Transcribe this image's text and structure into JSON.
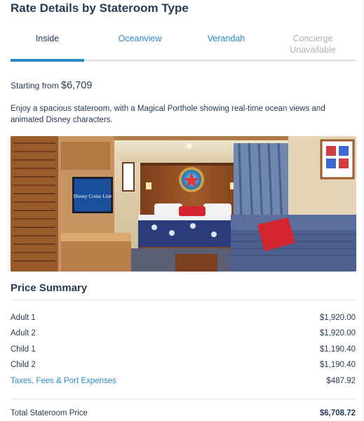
{
  "page": {
    "title": "Rate Details by Stateroom Type"
  },
  "tabs": [
    {
      "label": "Inside",
      "state": "active"
    },
    {
      "label": "Oceanview",
      "state": "link"
    },
    {
      "label": "Verandah",
      "state": "link"
    },
    {
      "label": "Concierge",
      "sublabel": "Unavailable",
      "state": "disabled"
    }
  ],
  "stateroom": {
    "starting_prefix": "Starting from",
    "starting_price": "$6,709",
    "description": "Enjoy a spacious stateroom, with a Magical Porthole showing real-time ocean views and animated Disney characters.",
    "tv_brand": "Disney Cruise Line"
  },
  "price_summary": {
    "title": "Price Summary",
    "rows": [
      {
        "label": "Adult 1",
        "amount": "$1,920.00"
      },
      {
        "label": "Adult 2",
        "amount": "$1,920.00"
      },
      {
        "label": "Child 1",
        "amount": "$1,190.40"
      },
      {
        "label": "Child 2",
        "amount": "$1,190.40"
      },
      {
        "label": "Taxes, Fees & Port Expenses",
        "amount": "$487.92"
      }
    ],
    "total_label": "Total Stateroom Price",
    "total_amount": "$6,708.72"
  },
  "colors": {
    "heading": "#253b56",
    "link": "#2a8ac4",
    "disabled": "#a8b1bb",
    "divider": "#dde1e5"
  }
}
